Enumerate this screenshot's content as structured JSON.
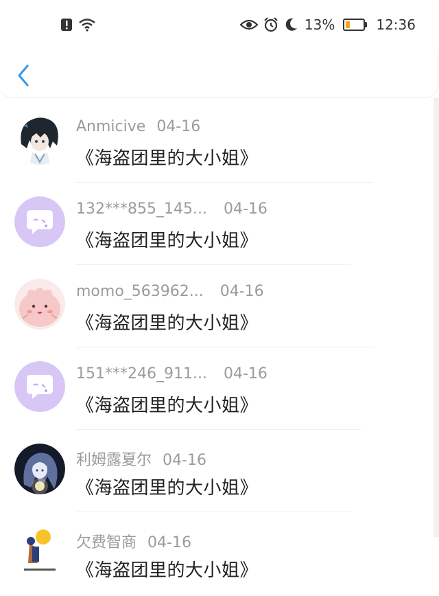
{
  "status_bar": {
    "battery_percent": "13%",
    "time": "12:36",
    "battery_level": 0.13,
    "icons": [
      "alert-icon",
      "wifi-icon",
      "eye-icon",
      "alarm-icon",
      "moon-icon",
      "battery-icon"
    ]
  },
  "header": {
    "back_icon": "chevron-left-icon"
  },
  "items": [
    {
      "user": "Anmicive",
      "date": "04-16",
      "title": "《海盗团里的大小姐》",
      "avatar": "anime-boy-avatar"
    },
    {
      "user": "132***855_145...",
      "date": "04-16",
      "title": "《海盗团里的大小姐》",
      "avatar": "purple-chat-avatar"
    },
    {
      "user": "momo_563962...",
      "date": "04-16",
      "title": "《海盗团里的大小姐》",
      "avatar": "pink-blob-avatar"
    },
    {
      "user": "151***246_911...",
      "date": "04-16",
      "title": "《海盗团里的大小姐》",
      "avatar": "purple-chat-avatar"
    },
    {
      "user": "利姆露夏尔",
      "date": "04-16",
      "title": "《海盗团里的大小姐》",
      "avatar": "anime-girl-avatar"
    },
    {
      "user": "欠费智商",
      "date": "04-16",
      "title": "《海盗团里的大小姐》",
      "avatar": "meme-avatar"
    }
  ],
  "colors": {
    "accent": "#3a9be8",
    "purple_avatar": "#d8c6f5",
    "pink_avatar": "#f6c8c8",
    "battery_fill": "#f2a31f"
  }
}
